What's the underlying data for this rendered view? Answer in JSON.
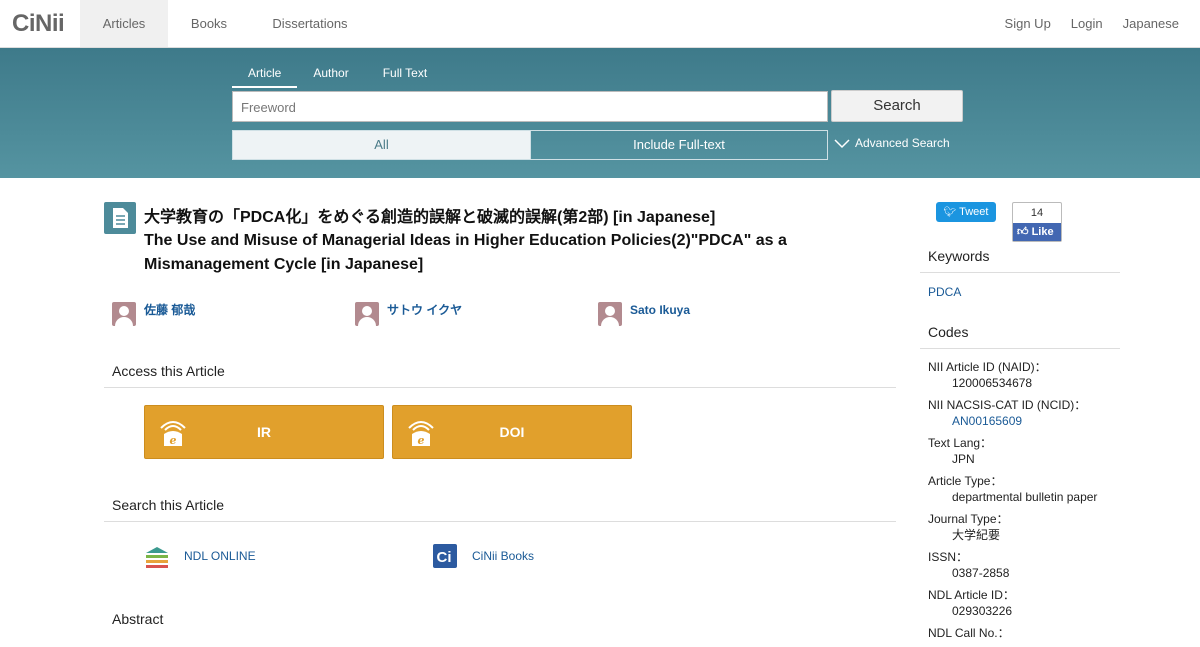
{
  "brand": {
    "logo": "CiNii"
  },
  "topnav": {
    "tabs": [
      {
        "label": "Articles"
      },
      {
        "label": "Books"
      },
      {
        "label": "Dissertations"
      }
    ],
    "right": [
      {
        "label": "Sign Up"
      },
      {
        "label": "Login"
      },
      {
        "label": "Japanese"
      }
    ]
  },
  "search": {
    "tabs": [
      {
        "label": "Article"
      },
      {
        "label": "Author"
      },
      {
        "label": "Full Text"
      }
    ],
    "placeholder": "Freeword",
    "button_label": "Search",
    "toggle": {
      "all": "All",
      "fulltext": "Include Full-text"
    },
    "advanced_label": "Advanced Search"
  },
  "article": {
    "title_ja": "大学教育の「PDCA化」をめぐる創造的誤解と破滅的誤解(第2部)  [in Japanese]",
    "title_en": "The Use and Misuse of Managerial Ideas in Higher Education Policies(2)\"PDCA\" as a Mismanagement Cycle  [in Japanese]",
    "authors": [
      {
        "name": "佐藤 郁哉"
      },
      {
        "name": "サトウ イクヤ"
      },
      {
        "name": "Sato Ikuya"
      }
    ]
  },
  "access": {
    "heading": "Access this Article",
    "buttons": [
      {
        "label": "IR"
      },
      {
        "label": "DOI"
      }
    ]
  },
  "search_article": {
    "heading": "Search this Article",
    "links": [
      {
        "label": "NDL ONLINE"
      },
      {
        "label": "CiNii Books"
      }
    ]
  },
  "abstract": {
    "heading": "Abstract"
  },
  "social": {
    "tweet_label": "Tweet",
    "like_count": "14",
    "like_label": "Like"
  },
  "sidebar": {
    "keywords_heading": "Keywords",
    "keywords": [
      {
        "label": "PDCA"
      }
    ],
    "codes_heading": "Codes",
    "codes": [
      {
        "label": "NII Article ID (NAID)：",
        "value": "120006534678"
      },
      {
        "label": "NII NACSIS-CAT ID (NCID)：",
        "value": "AN00165609"
      },
      {
        "label": "Text Lang：",
        "value": "JPN"
      },
      {
        "label": "Article Type：",
        "value": "departmental bulletin paper"
      },
      {
        "label": "Journal Type：",
        "value": "大学紀要"
      },
      {
        "label": "ISSN：",
        "value": "0387-2858"
      },
      {
        "label": "NDL Article ID：",
        "value": "029303226"
      },
      {
        "label": "NDL Call No.：",
        "value": ""
      }
    ]
  },
  "colors": {
    "band": "#4a8795",
    "accent_button": "#e1a02c",
    "link": "#1a5a96"
  }
}
